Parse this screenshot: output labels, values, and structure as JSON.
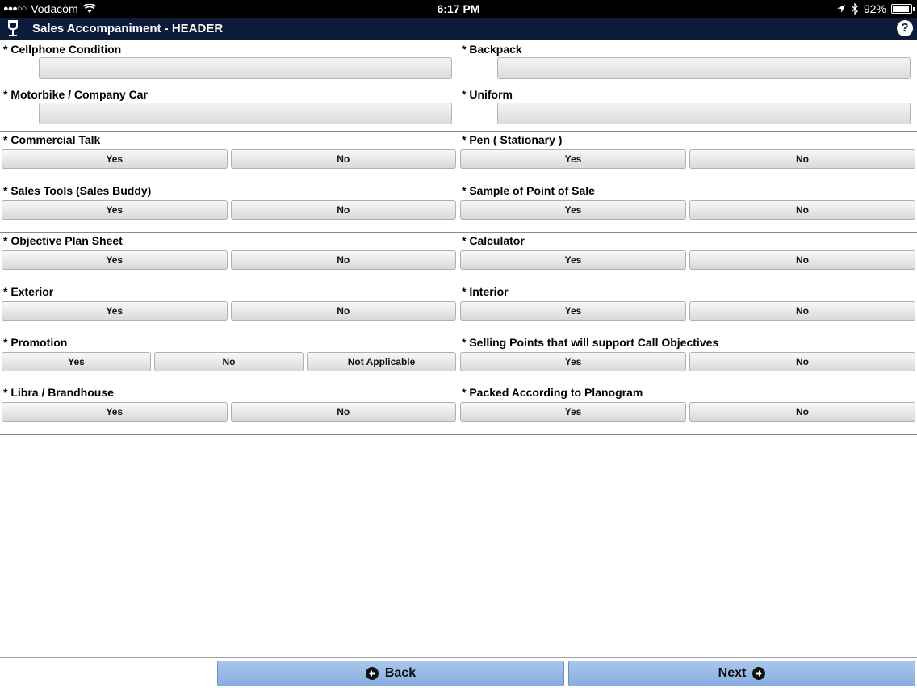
{
  "status_bar": {
    "carrier": "Vodacom",
    "time": "6:17 PM",
    "battery": "92%",
    "battery_level": 0.92
  },
  "header": {
    "title": "Sales Accompaniment - HEADER",
    "help_label": "?"
  },
  "fields": {
    "cellphone": "* Cellphone Condition",
    "backpack": "* Backpack",
    "motorbike": "* Motorbike / Company Car",
    "uniform": "* Uniform",
    "commercial_talk": "* Commercial Talk",
    "pen": "* Pen ( Stationary )",
    "sales_tools": "* Sales Tools (Sales Buddy)",
    "sample_pos": "* Sample of Point of Sale",
    "objective_plan": "* Objective Plan Sheet",
    "calculator": "* Calculator",
    "exterior": "* Exterior",
    "interior": "* Interior",
    "promotion": "* Promotion",
    "selling_points": "* Selling Points that will support Call Objectives",
    "libra": "* Libra / Brandhouse",
    "packed": "* Packed According to Planogram"
  },
  "options": {
    "yes": "Yes",
    "no": "No",
    "na": "Not Applicable"
  },
  "footer": {
    "back_label": "Back",
    "next_label": "Next"
  },
  "colors": {
    "header_bg": "#0d1b3a",
    "nav_button": "#98bae6"
  }
}
